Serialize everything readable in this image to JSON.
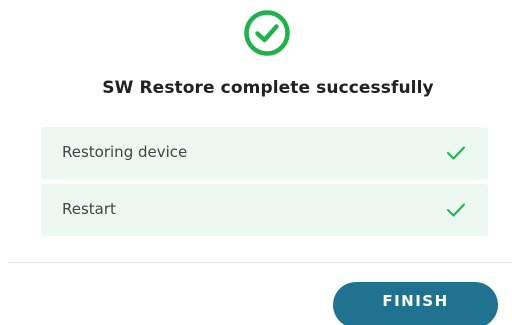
{
  "dialog": {
    "status_icon": "check-circle-icon",
    "title": "SW Restore complete successfully",
    "steps": [
      {
        "label": "Restoring device",
        "status_icon": "check-icon"
      },
      {
        "label": "Restart",
        "status_icon": "check-icon"
      }
    ],
    "finish_label": "FINISH"
  },
  "colors": {
    "success_green": "#21b24b",
    "step_background": "#ecf8f1",
    "button_background": "#1f7391",
    "button_text": "#ffffff",
    "title_text": "#222222",
    "step_text": "#444444",
    "divider": "#e2e2e2"
  }
}
